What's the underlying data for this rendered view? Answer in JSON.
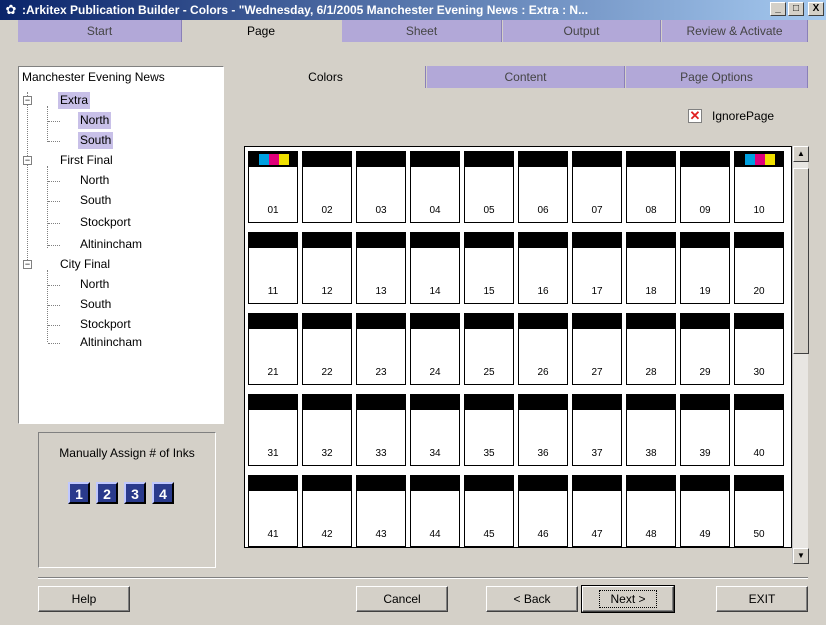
{
  "window": {
    "title": ":Arkitex Publication Builder - Colors - \"Wednesday, 6/1/2005 Manchester Evening News : Extra : N...",
    "minimize": "_",
    "maximize": "□",
    "close": "X"
  },
  "main_tabs": [
    "Start",
    "Page",
    "Sheet",
    "Output",
    "Review & Activate"
  ],
  "tree": {
    "root": "Manchester Evening News",
    "groups": [
      {
        "label": "Extra",
        "children": [
          "North",
          "South"
        ]
      },
      {
        "label": "First Final",
        "children": [
          "North",
          "South",
          "Stockport",
          "Altinincham"
        ]
      },
      {
        "label": "City Final",
        "children": [
          "North",
          "South",
          "Stockport",
          "Altinincham"
        ]
      }
    ]
  },
  "sub_tabs": [
    "Colors",
    "Content",
    "Page Options"
  ],
  "ignore_page": {
    "label": "IgnorePage",
    "checked": true
  },
  "inks": {
    "label": "Manually Assign # of Inks",
    "buttons": [
      "1",
      "2",
      "3",
      "4"
    ]
  },
  "pages": [
    "01",
    "02",
    "03",
    "04",
    "05",
    "06",
    "07",
    "08",
    "09",
    "10",
    "11",
    "12",
    "13",
    "14",
    "15",
    "16",
    "17",
    "18",
    "19",
    "20",
    "21",
    "22",
    "23",
    "24",
    "25",
    "26",
    "27",
    "28",
    "29",
    "30",
    "31",
    "32",
    "33",
    "34",
    "35",
    "36",
    "37",
    "38",
    "39",
    "40",
    "41",
    "42",
    "43",
    "44",
    "45",
    "46",
    "47",
    "48",
    "49",
    "50"
  ],
  "color_pages": [
    "01",
    "10"
  ],
  "process_colors": {
    "cyan": "#00a0e0",
    "magenta": "#e0007a",
    "yellow": "#f0e000"
  },
  "buttons": {
    "help": "Help",
    "cancel": "Cancel",
    "back": "< Back",
    "next": "Next >",
    "exit": "EXIT"
  }
}
